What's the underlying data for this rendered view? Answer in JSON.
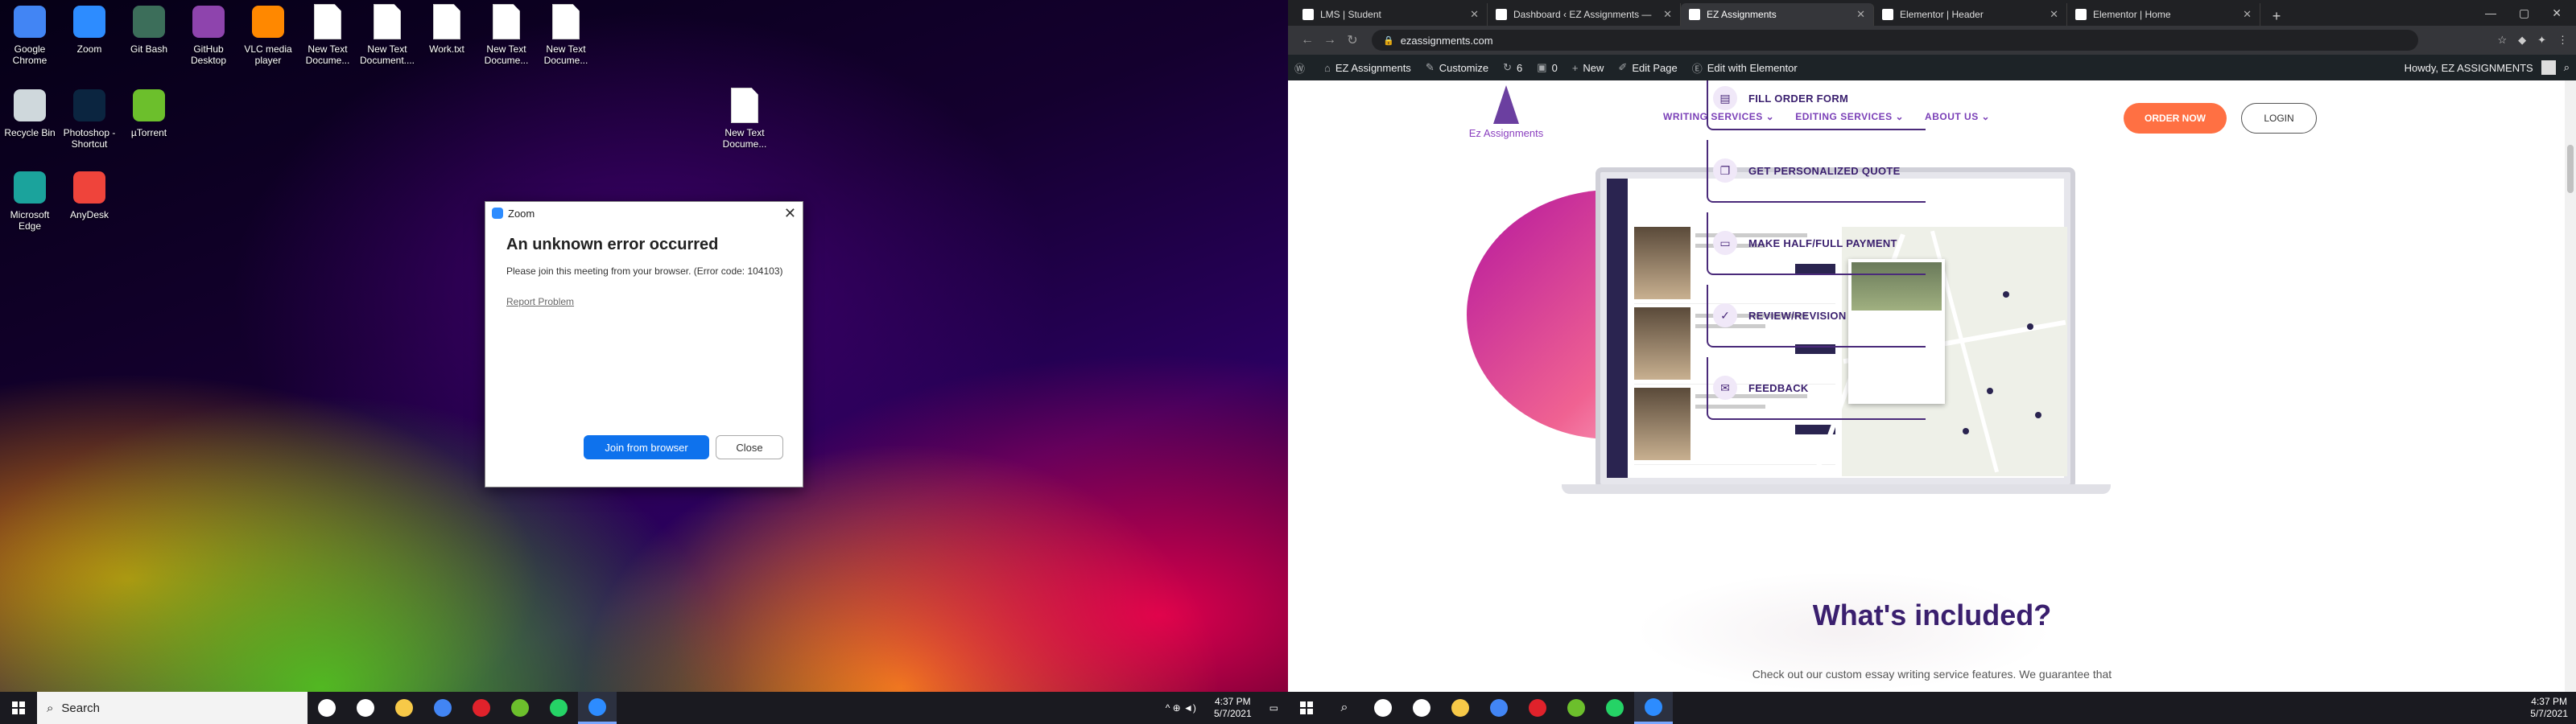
{
  "left_screen": {
    "desktop_icons": [
      {
        "label": "Google Chrome",
        "icon": "chrome-icon",
        "color": "#4285f4"
      },
      {
        "label": "Zoom",
        "icon": "zoom-icon",
        "color": "#2d8cff"
      },
      {
        "label": "Git Bash",
        "icon": "git-bash-icon",
        "color": "#3c6e5a"
      },
      {
        "label": "GitHub Desktop",
        "icon": "github-desktop-icon",
        "color": "#8e44ad"
      },
      {
        "label": "VLC media player",
        "icon": "vlc-icon",
        "color": "#ff8800"
      },
      {
        "label": "New Text Docume...",
        "icon": "text-document-icon",
        "color": "#ffffff"
      },
      {
        "label": "New Text Document....",
        "icon": "text-document-icon",
        "color": "#ffffff"
      },
      {
        "label": "Work.txt",
        "icon": "text-document-icon",
        "color": "#ffffff"
      },
      {
        "label": "New Text Docume...",
        "icon": "text-document-icon",
        "color": "#ffffff"
      },
      {
        "label": "New Text Docume...",
        "icon": "text-document-icon",
        "color": "#ffffff"
      },
      {
        "label": "Recycle Bin",
        "icon": "recycle-bin-icon",
        "color": "#cfd8dc"
      },
      {
        "label": "Photoshop - Shortcut",
        "icon": "photoshop-icon",
        "color": "#0b2540"
      },
      {
        "label": "µTorrent",
        "icon": "utorrent-icon",
        "color": "#6cbf2c"
      },
      {
        "label": "New Text Docume...",
        "icon": "text-document-icon",
        "color": "#ffffff"
      },
      {
        "label": "Microsoft Edge",
        "icon": "edge-icon",
        "color": "#1ba39c"
      },
      {
        "label": "AnyDesk",
        "icon": "anydesk-icon",
        "color": "#ef443b"
      }
    ],
    "dialog": {
      "app": "Zoom",
      "heading": "An unknown error occurred",
      "message": "Please join this meeting from your browser. (Error code: 104103)",
      "link": "Report Problem",
      "primary_button": "Join from browser",
      "secondary_button": "Close",
      "close_glyph": "✕"
    },
    "taskbar": {
      "search_placeholder": "Search",
      "apps": [
        {
          "icon": "cortana-icon",
          "color": "#ffffff"
        },
        {
          "icon": "task-view-icon",
          "color": "#ffffff"
        },
        {
          "icon": "file-explorer-icon",
          "color": "#f7c948"
        },
        {
          "icon": "chrome-icon",
          "color": "#4285f4"
        },
        {
          "icon": "opera-icon",
          "color": "#e0222b"
        },
        {
          "icon": "utorrent-icon",
          "color": "#6cbf2c"
        },
        {
          "icon": "whatsapp-icon",
          "color": "#25d366"
        },
        {
          "icon": "zoom-icon",
          "color": "#2d8cff",
          "active": true
        }
      ],
      "time": "4:37 PM",
      "date": "5/7/2021",
      "tray_glyphs": "^ ⊕ ◄)"
    }
  },
  "right_screen": {
    "tabs": [
      {
        "title": "LMS | Student"
      },
      {
        "title": "Dashboard ‹ EZ Assignments —"
      },
      {
        "title": "EZ Assignments",
        "active": true
      },
      {
        "title": "Elementor | Header"
      },
      {
        "title": "Elementor | Home"
      }
    ],
    "new_tab": "+",
    "address": "ezassignments.com",
    "admin_bar": {
      "items": [
        {
          "label": "EZ Assignments",
          "icon": "home-icon"
        },
        {
          "label": "Customize",
          "icon": "brush-icon"
        },
        {
          "label": "6",
          "icon": "updates-icon"
        },
        {
          "label": "0",
          "icon": "comments-icon"
        },
        {
          "label": "New",
          "icon": "plus-icon"
        },
        {
          "label": "Edit Page",
          "icon": "pencil-icon"
        },
        {
          "label": "Edit with Elementor",
          "icon": "elementor-icon"
        }
      ],
      "greeting": "Howdy, EZ ASSIGNMENTS"
    },
    "site": {
      "logo_text": "Ez Assignments",
      "nav": [
        "WRITING SERVICES ⌄",
        "EDITING SERVICES ⌄",
        "ABOUT US ⌄"
      ],
      "order_button": "ORDER NOW",
      "login_button": "LOGIN",
      "steps": [
        {
          "label": "FILL ORDER FORM",
          "icon": "form-icon"
        },
        {
          "label": "GET PERSONALIZED QUOTE",
          "icon": "quote-icon"
        },
        {
          "label": "MAKE HALF/FULL PAYMENT",
          "icon": "payment-icon"
        },
        {
          "label": "REVIEW/REVISION",
          "icon": "revision-icon"
        },
        {
          "label": "FEEDBACK",
          "icon": "feedback-icon"
        }
      ],
      "section_title": "What's included?",
      "section_subtitle": "Check out our custom essay writing service features. We guarantee that"
    },
    "taskbar": {
      "time": "4:37 PM",
      "date": "5/7/2021"
    },
    "colors": {
      "brand_purple": "#3a1f6e",
      "accent_orange": "#ff7043",
      "zoom_blue": "#0e72ed"
    }
  }
}
